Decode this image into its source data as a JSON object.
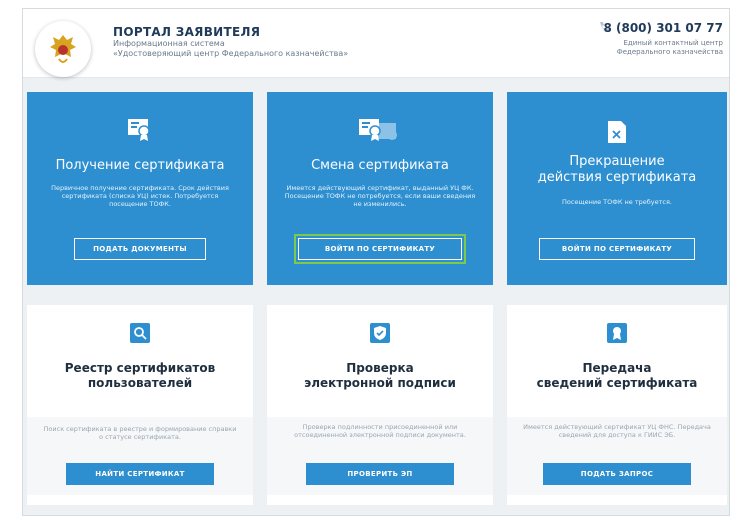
{
  "header": {
    "title": "ПОРТАЛ ЗАЯВИТЕЛЯ",
    "subtitle_line1": "Информационная система",
    "subtitle_line2": "«Удостоверяющий центр Федерального казначейства»",
    "phone": "8 (800) 301 07 77",
    "phone_caption_line1": "Единый контактный центр",
    "phone_caption_line2": "Федерального казначейства"
  },
  "cards": [
    {
      "title_line1": "Получение сертификата",
      "title_line2": "",
      "desc": "Первичное получение сертификата. Срок действия сертификата (списка УЦ) истек. Потребуется посещение ТОФК.",
      "button": "ПОДАТЬ ДОКУМЕНТЫ",
      "icon": "certificate-icon"
    },
    {
      "title_line1": "Смена сертификата",
      "title_line2": "",
      "desc": "Имеется действующий сертификат, выданный УЦ ФК. Посещение ТОФК не потребуется, если ваши сведения не изменились.",
      "button": "ВОЙТИ ПО СЕРТИФИКАТУ",
      "icon": "certificate-replace-icon"
    },
    {
      "title_line1": "Прекращение",
      "title_line2": "действия сертификата",
      "desc": "Посещение ТОФК не требуется.",
      "button": "ВОЙТИ ПО СЕРТИФИКАТУ",
      "icon": "certificate-revoke-icon"
    },
    {
      "title_line1": "Реестр сертификатов",
      "title_line2": "пользователей",
      "desc": "Поиск сертификата в реестре и формирование справки о статусе сертификата.",
      "button": "НАЙТИ СЕРТИФИКАТ",
      "icon": "registry-search-icon"
    },
    {
      "title_line1": "Проверка",
      "title_line2": "электронной подписи",
      "desc": "Проверка подлинности присоединенной или отсоединенной электронной подписи документа.",
      "button": "ПРОВЕРИТЬ ЭП",
      "icon": "signature-check-icon"
    },
    {
      "title_line1": "Передача",
      "title_line2": "сведений сертификата",
      "desc": "Имеется действующий сертификат УЦ ФНС. Передача сведений для доступа к ГИИС ЭБ.",
      "button": "ПОДАТЬ ЗАПРОС",
      "icon": "certificate-transfer-icon"
    }
  ],
  "colors": {
    "accent": "#2e8fd0",
    "highlight": "#7ec84a",
    "background": "#eef1f4"
  }
}
